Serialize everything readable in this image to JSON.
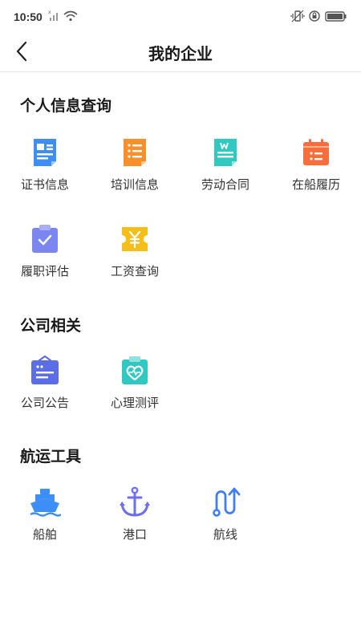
{
  "status_bar": {
    "time": "10:50"
  },
  "nav": {
    "title": "我的企业"
  },
  "sections": [
    {
      "title": "个人信息查询",
      "items": [
        {
          "label": "证书信息",
          "icon": "certificate-icon"
        },
        {
          "label": "培训信息",
          "icon": "training-icon"
        },
        {
          "label": "劳动合同",
          "icon": "contract-icon"
        },
        {
          "label": "在船履历",
          "icon": "calendar-icon"
        },
        {
          "label": "履职评估",
          "icon": "evaluation-icon"
        },
        {
          "label": "工资查询",
          "icon": "salary-icon"
        }
      ]
    },
    {
      "title": "公司相关",
      "items": [
        {
          "label": "公司公告",
          "icon": "announcement-icon"
        },
        {
          "label": "心理测评",
          "icon": "mental-test-icon"
        }
      ]
    },
    {
      "title": "航运工具",
      "items": [
        {
          "label": "船舶",
          "icon": "ship-icon"
        },
        {
          "label": "港口",
          "icon": "anchor-icon"
        },
        {
          "label": "航线",
          "icon": "route-icon"
        }
      ]
    }
  ],
  "colors": {
    "blue": "#3d8ef7",
    "orange": "#f7902a",
    "teal": "#2fc9c2",
    "red_orange": "#f76d3c",
    "purple": "#7b86f0",
    "yellow": "#f5be1b",
    "indigo": "#5b6ee8"
  }
}
